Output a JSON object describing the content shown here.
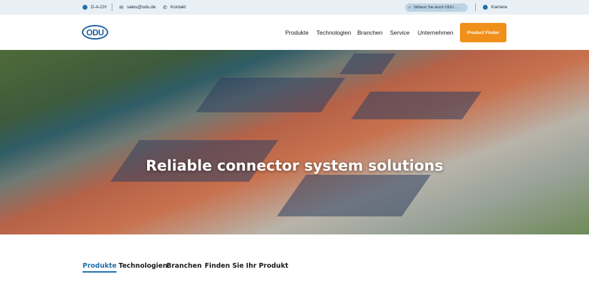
{
  "topbar": {
    "region": "D-A-CH",
    "email": "sales@odu.de",
    "contact": "Kontakt",
    "search_placeholder": "Stöbern Sie durch ODU ...",
    "career": "Karriere"
  },
  "header": {
    "logo": "ODU",
    "nav": [
      "Produkte",
      "Technologien",
      "Branchen",
      "Service",
      "Unternehmen"
    ],
    "cta": "Product Finder",
    "cta_color": "#f0901a"
  },
  "hero": {
    "title": "Reliable connector system solutions"
  },
  "tabs": {
    "items": [
      "Produkte",
      "Technologien",
      "Branchen",
      "Finden Sie Ihr Produkt"
    ],
    "active": "Produkte",
    "accent": "#1f6fa8"
  }
}
